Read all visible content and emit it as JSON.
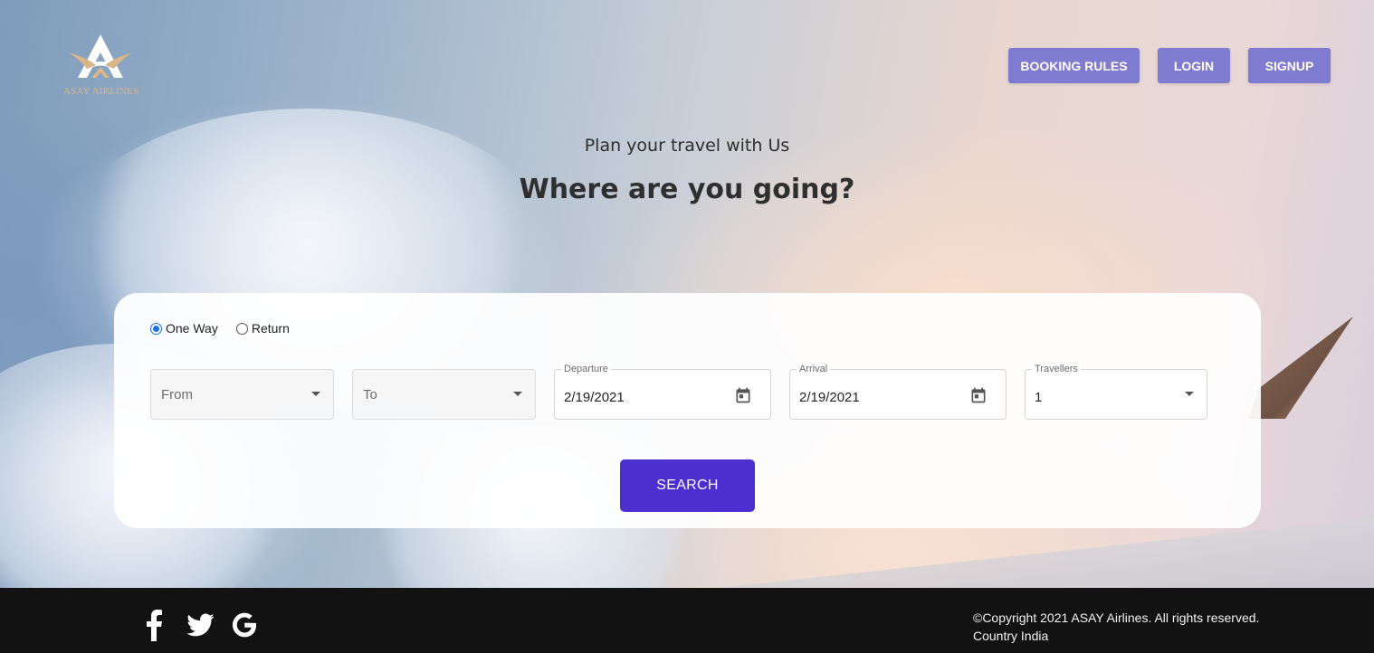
{
  "brand": {
    "name": "ASAY AIRLINES",
    "accent": "#d9b58a"
  },
  "nav": {
    "booking_rules": "BOOKING RULES",
    "login": "LOGIN",
    "signup": "SIGNUP",
    "color": "#7f7bd0"
  },
  "hero": {
    "subtitle": "Plan your travel with Us",
    "headline": "Where are you going?"
  },
  "search_form": {
    "trip_types": [
      {
        "label": "One Way",
        "checked": true
      },
      {
        "label": "Return",
        "checked": false
      }
    ],
    "from": {
      "placeholder": "From",
      "value": ""
    },
    "to": {
      "placeholder": "To",
      "value": ""
    },
    "departure": {
      "label": "Departure",
      "value": "2/19/2021"
    },
    "arrival": {
      "label": "Arrival",
      "value": "2/19/2021"
    },
    "travellers": {
      "label": "Travellers",
      "value": "1"
    },
    "search_label": "SEARCH",
    "search_color": "#4b2fd1"
  },
  "footer": {
    "social_icons": [
      "facebook-icon",
      "twitter-icon",
      "google-icon"
    ],
    "copyright": "©Copyright 2021 ASAY Airlines. All rights reserved.",
    "country": "Country India"
  }
}
